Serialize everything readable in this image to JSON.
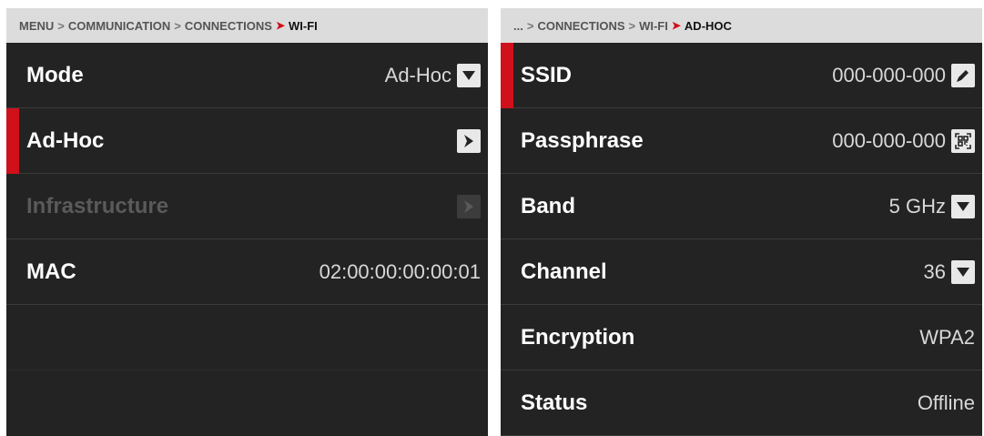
{
  "left": {
    "breadcrumb": {
      "items": [
        "MENU",
        "COMMUNICATION",
        "CONNECTIONS"
      ],
      "current": "WI-FI"
    },
    "rows": {
      "mode": {
        "label": "Mode",
        "value": "Ad-Hoc",
        "icon": "chevron-down-icon"
      },
      "adhoc": {
        "label": "Ad-Hoc",
        "icon": "chevron-right-icon"
      },
      "infrastructure": {
        "label": "Infrastructure",
        "icon": "chevron-right-icon"
      },
      "mac": {
        "label": "MAC",
        "value": "02:00:00:00:00:01"
      }
    }
  },
  "right": {
    "breadcrumb": {
      "items": [
        "...",
        "CONNECTIONS",
        "WI-FI"
      ],
      "current": "AD-HOC"
    },
    "rows": {
      "ssid": {
        "label": "SSID",
        "value": "000-000-000",
        "icon": "pencil-icon"
      },
      "passphrase": {
        "label": "Passphrase",
        "value": "000-000-000",
        "icon": "qr-code-icon"
      },
      "band": {
        "label": "Band",
        "value": "5 GHz",
        "icon": "chevron-down-icon"
      },
      "channel": {
        "label": "Channel",
        "value": "36",
        "icon": "chevron-down-icon"
      },
      "encryption": {
        "label": "Encryption",
        "value": "WPA2"
      },
      "status": {
        "label": "Status",
        "value": "Offline"
      }
    }
  },
  "colors": {
    "accent": "#d0101b",
    "panel_bg": "#232323",
    "breadcrumb_bg": "#dcdcdc"
  }
}
